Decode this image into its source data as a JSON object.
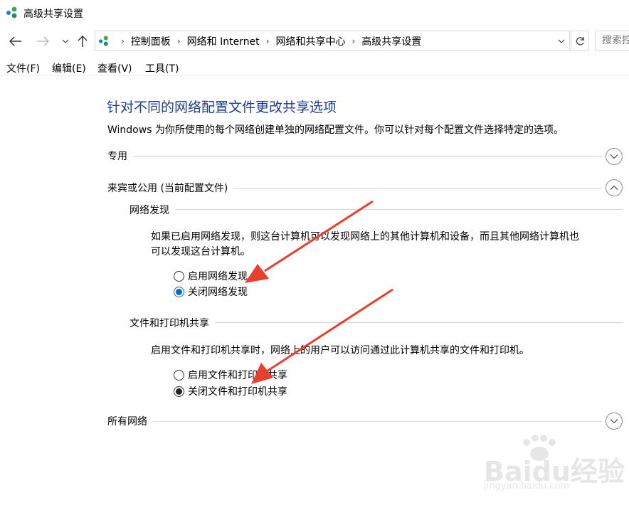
{
  "window": {
    "title": "高级共享设置",
    "icon": "network-icon"
  },
  "nav": {
    "back_icon": "back-arrow-icon",
    "forward_icon": "forward-arrow-icon",
    "recent_icon": "chevron-down-icon",
    "up_icon": "up-arrow-icon",
    "breadcrumbs": [
      "控制面板",
      "网络和 Internet",
      "网络和共享中心",
      "高级共享设置"
    ],
    "search_placeholder": "搜索控"
  },
  "menu": [
    "文件(F)",
    "编辑(E)",
    "查看(V)",
    "工具(T)"
  ],
  "content": {
    "heading": "针对不同的网络配置文件更改共享选项",
    "description": "Windows 为你所使用的每个网络创建单独的网络配置文件。你可以针对每个配置文件选择特定的选项。",
    "profiles": {
      "private": {
        "label": "专用",
        "expanded": false
      },
      "guest": {
        "label": "来宾或公用 (当前配置文件)",
        "expanded": true,
        "network_discovery": {
          "label": "网络发现",
          "description_line1": "如果已启用网络发现，则这台计算机可以发现网络上的其他计算机和设备，而且其他网络计算机也",
          "description_line2": "可以发现这台计算机。",
          "option_on": "启用网络发现",
          "option_off": "关闭网络发现",
          "selected": "off"
        },
        "file_printer_sharing": {
          "label": "文件和打印机共享",
          "description": "启用文件和打印机共享时，网络上的用户可以访问通过此计算机共享的文件和打印机。",
          "option_on": "启用文件和打印机共享",
          "option_off": "关闭文件和打印机共享",
          "selected": "off"
        }
      },
      "all": {
        "label": "所有网络",
        "expanded": false
      }
    }
  },
  "colors": {
    "heading": "#1e3f8f",
    "arrow": "#e8402f",
    "radio_selected": "#0a64d2"
  },
  "watermark": {
    "text": "Baidu经验",
    "url": "jingyan.baidu.com"
  }
}
